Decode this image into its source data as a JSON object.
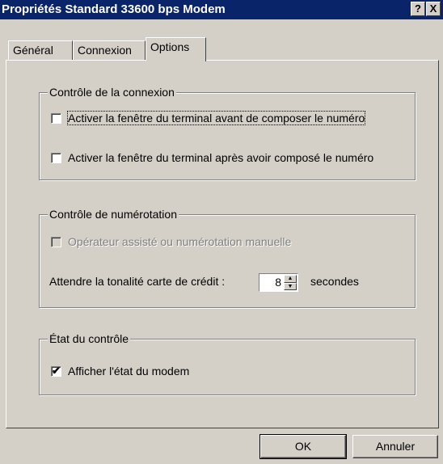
{
  "window": {
    "title": "Propriétés Standard 33600 bps Modem",
    "help_label": "?",
    "close_label": "X"
  },
  "tabs": [
    {
      "label": "Général",
      "active": false
    },
    {
      "label": "Connexion",
      "active": false
    },
    {
      "label": "Options",
      "active": true
    }
  ],
  "connection_control": {
    "legend": "Contrôle de la connexion",
    "before_dial_label": "Activer la fenêtre du terminal avant de composer le numéro",
    "before_dial_checked": false,
    "after_dial_label": "Activer la fenêtre du terminal après avoir composé le numéro",
    "after_dial_checked": false
  },
  "dial_control": {
    "legend": "Contrôle de numérotation",
    "operator_label": "Opérateur assisté ou numérotation manuelle",
    "operator_checked": false,
    "operator_enabled": false,
    "wait_label": "Attendre la tonalité carte de crédit :",
    "wait_value": "8",
    "wait_unit": "secondes"
  },
  "status_control": {
    "legend": "État du contrôle",
    "show_status_label": "Afficher l'état du modem",
    "show_status_checked": true
  },
  "buttons": {
    "ok": "OK",
    "cancel": "Annuler"
  }
}
